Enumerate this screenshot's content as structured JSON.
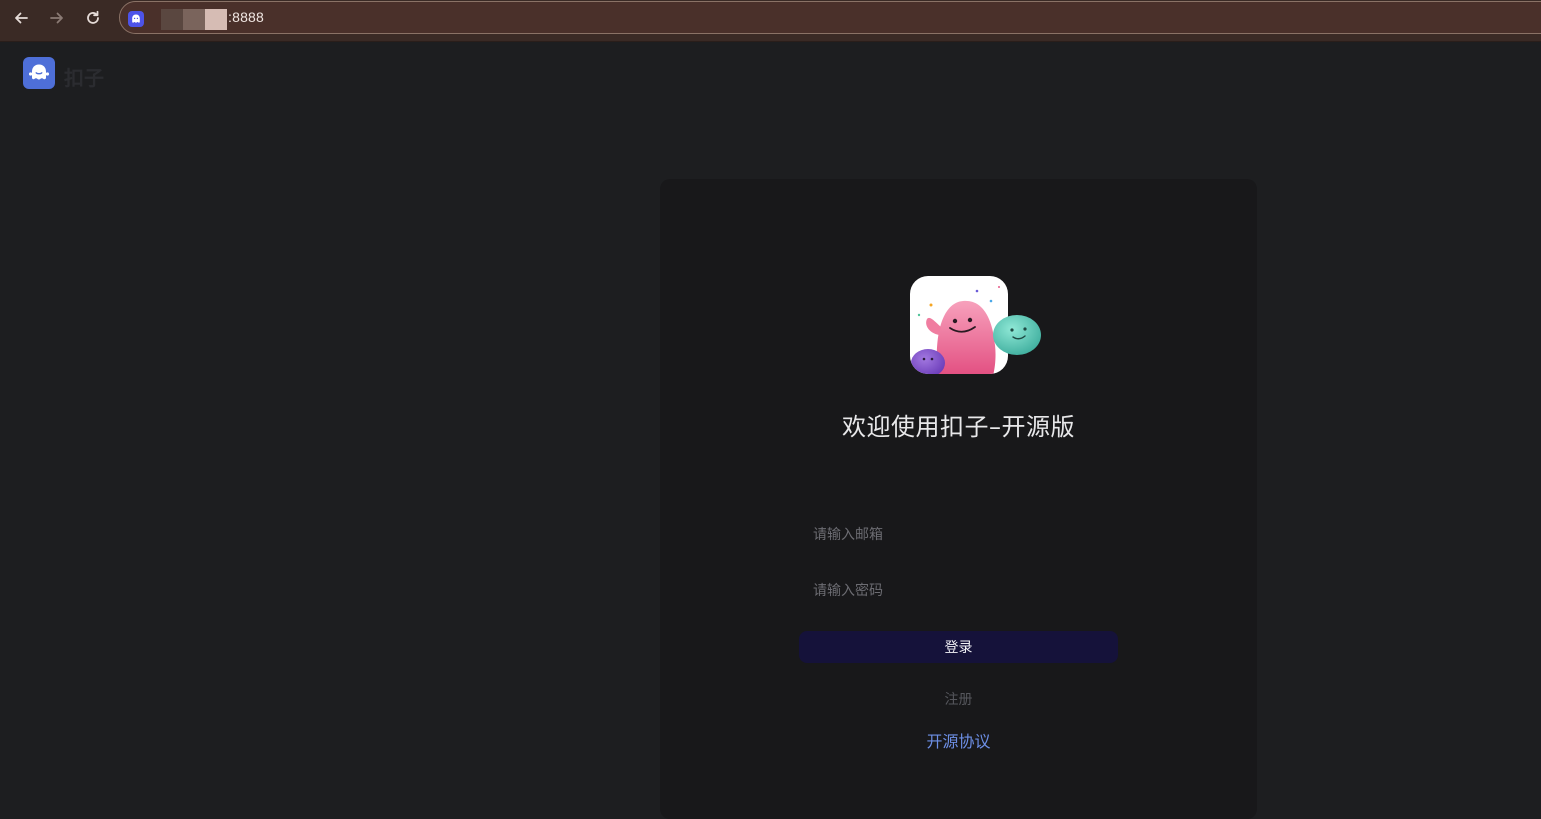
{
  "browser": {
    "url": ":8888",
    "icons": {
      "back": "back-arrow-icon",
      "forward": "forward-arrow-icon",
      "reload": "reload-icon",
      "site": "site-favicon-icon"
    }
  },
  "header": {
    "app_name": "扣子",
    "logo_icon": "coze-logo-icon"
  },
  "login": {
    "mascot": "mascot-illustration",
    "title": "欢迎使用扣子–开源版",
    "email_placeholder": "请输入邮箱",
    "password_placeholder": "请输入密码",
    "login_label": "登录",
    "register_label": "注册",
    "license_label": "开源协议"
  },
  "colors": {
    "page_bg": "#1d1e20",
    "card_bg": "#18181a",
    "primary_button": "#15123a",
    "link": "#6d8fe6",
    "browser_chrome": "#3a2a25"
  }
}
